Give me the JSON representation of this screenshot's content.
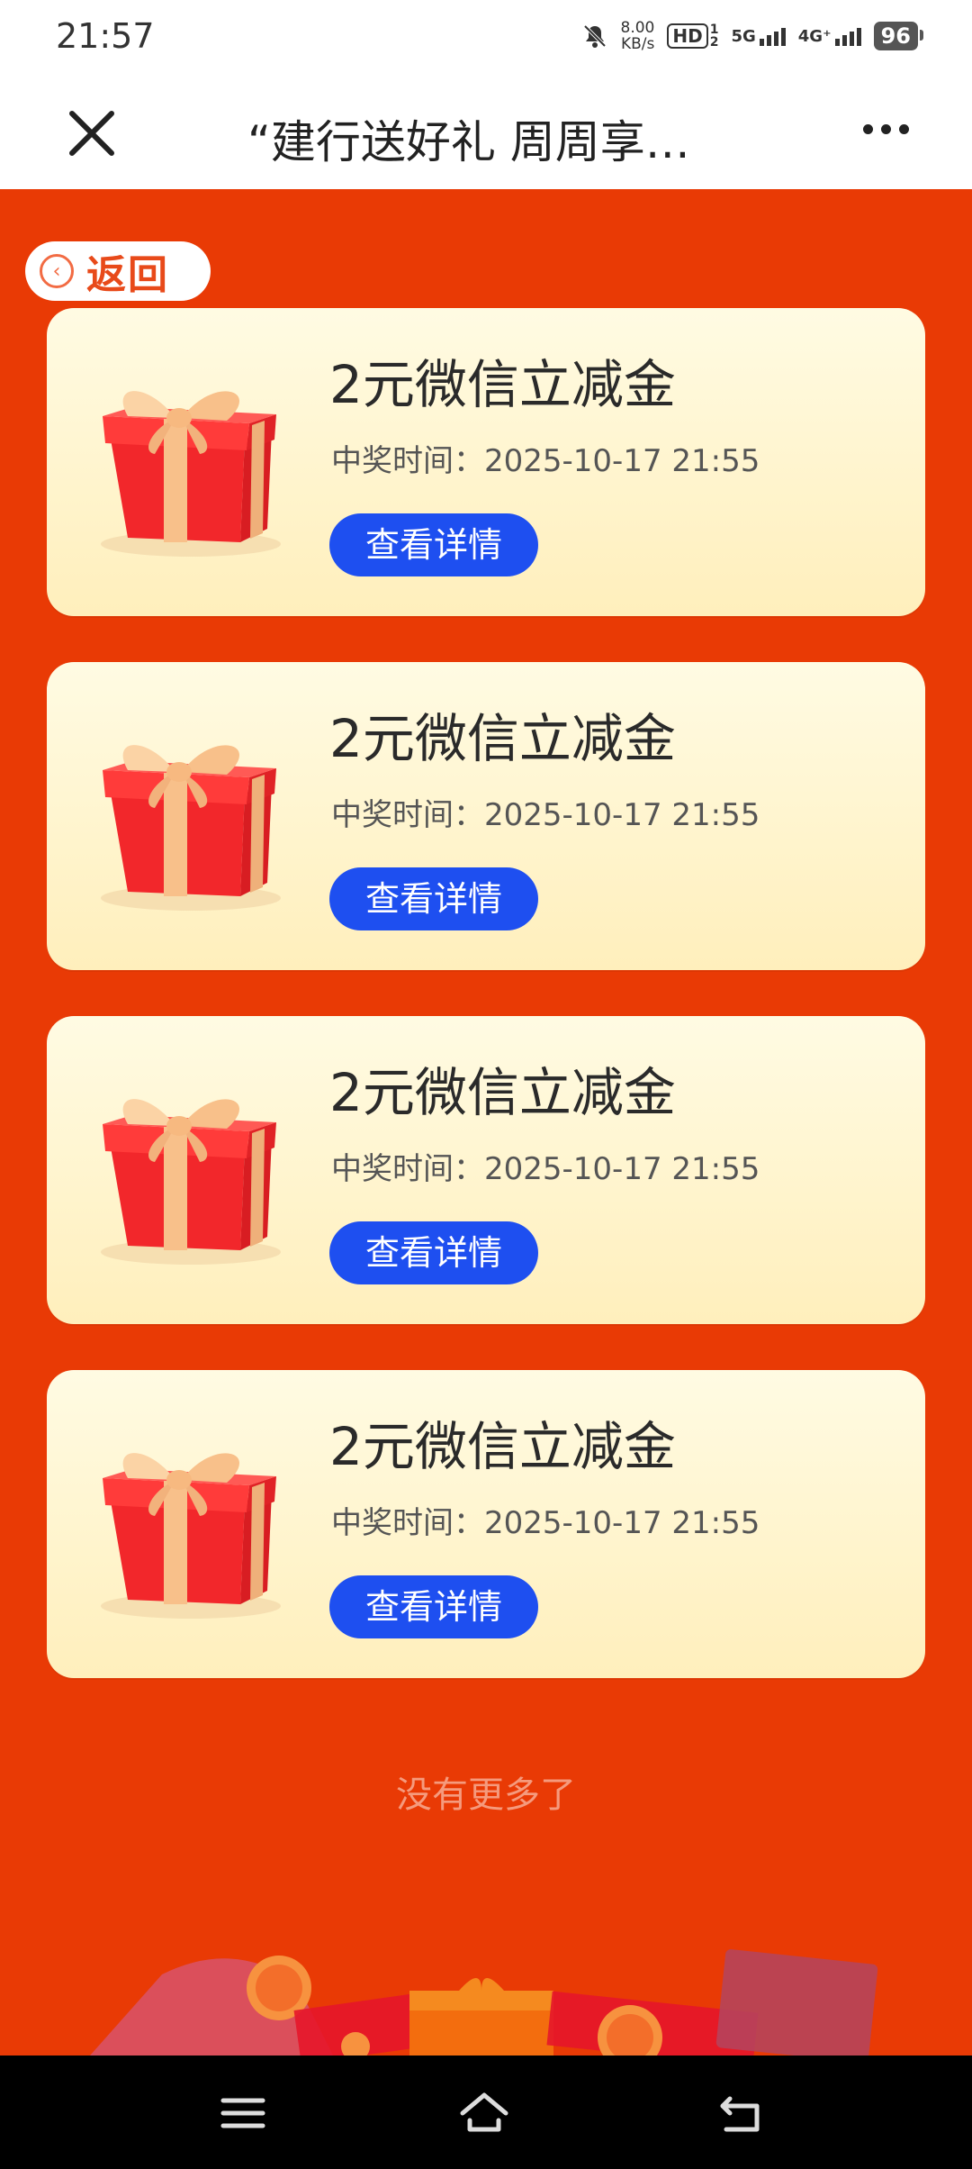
{
  "status_bar": {
    "time": "21:57",
    "speed_value": "8.00",
    "speed_unit": "KB/s",
    "hd": "HD",
    "hd_sub_top": "1",
    "hd_sub_bottom": "2",
    "net1": "5G",
    "net2": "4G⁺",
    "battery": "96"
  },
  "nav": {
    "title": "“建行送好礼 周周享…"
  },
  "back_label": "返回",
  "prizes": [
    {
      "name": "2元微信立减金",
      "time_label": "中奖时间：",
      "time": "2025-10-17 21:55",
      "button": "查看详情"
    },
    {
      "name": "2元微信立减金",
      "time_label": "中奖时间：",
      "time": "2025-10-17 21:55",
      "button": "查看详情"
    },
    {
      "name": "2元微信立减金",
      "time_label": "中奖时间：",
      "time": "2025-10-17 21:55",
      "button": "查看详情"
    },
    {
      "name": "2元微信立减金",
      "time_label": "中奖时间：",
      "time": "2025-10-17 21:55",
      "button": "查看详情"
    }
  ],
  "no_more": "没有更多了",
  "colors": {
    "background": "#e93a05",
    "button": "#1e4ff0",
    "card_top": "#fffbe3",
    "card_bottom": "#ffefbc"
  }
}
